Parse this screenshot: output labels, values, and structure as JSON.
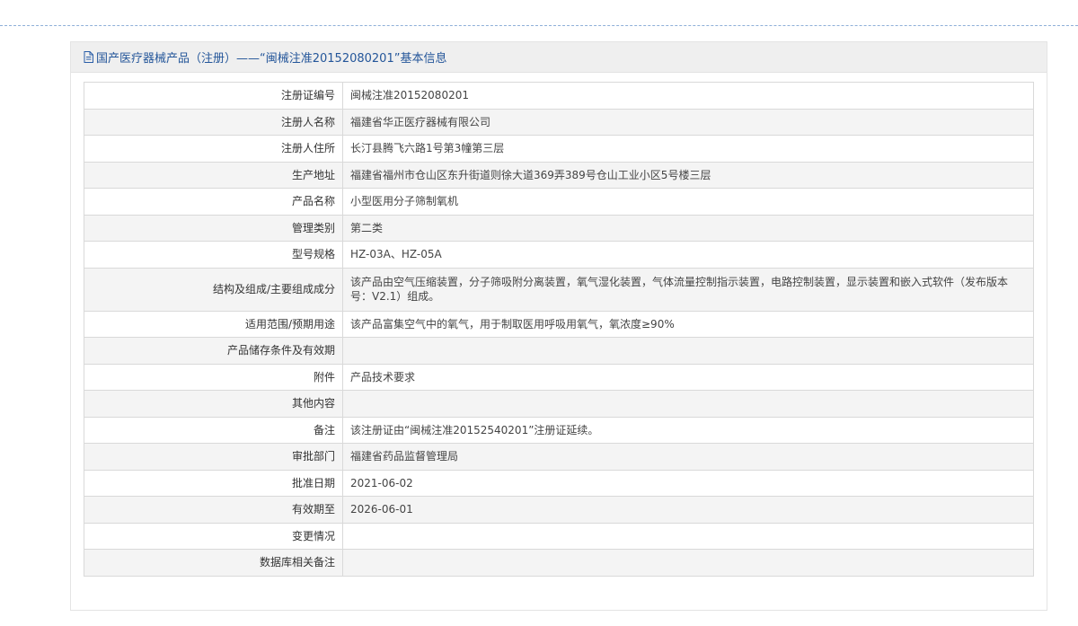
{
  "panel": {
    "icon": "document-icon",
    "title": "国产医疗器械产品（注册）——“闽械注准20152080201”基本信息"
  },
  "rows": [
    {
      "label": "注册证编号",
      "value": "闽械注准20152080201"
    },
    {
      "label": "注册人名称",
      "value": "福建省华正医疗器械有限公司"
    },
    {
      "label": "注册人住所",
      "value": "长汀县腾飞六路1号第3幢第三层"
    },
    {
      "label": "生产地址",
      "value": "福建省福州市仓山区东升街道则徐大道369弄389号仓山工业小区5号楼三层"
    },
    {
      "label": "产品名称",
      "value": "小型医用分子筛制氧机"
    },
    {
      "label": "管理类别",
      "value": "第二类"
    },
    {
      "label": "型号规格",
      "value": "HZ-03A、HZ-05A"
    },
    {
      "label": "结构及组成/主要组成成分",
      "value": "该产品由空气压缩装置，分子筛吸附分离装置，氧气湿化装置，气体流量控制指示装置，电路控制装置，显示装置和嵌入式软件（发布版本号：V2.1）组成。"
    },
    {
      "label": "适用范围/预期用途",
      "value": "该产品富集空气中的氧气，用于制取医用呼吸用氧气，氧浓度≥90%"
    },
    {
      "label": "产品储存条件及有效期",
      "value": ""
    },
    {
      "label": "附件",
      "value": "产品技术要求"
    },
    {
      "label": "其他内容",
      "value": ""
    },
    {
      "label": "备注",
      "value": "该注册证由“闽械注准20152540201”注册证延续。"
    },
    {
      "label": "审批部门",
      "value": "福建省药品监督管理局"
    },
    {
      "label": "批准日期",
      "value": "2021-06-02"
    },
    {
      "label": "有效期至",
      "value": "2026-06-01"
    },
    {
      "label": "变更情况",
      "value": ""
    },
    {
      "label": "数据库相关备注",
      "value": ""
    }
  ]
}
